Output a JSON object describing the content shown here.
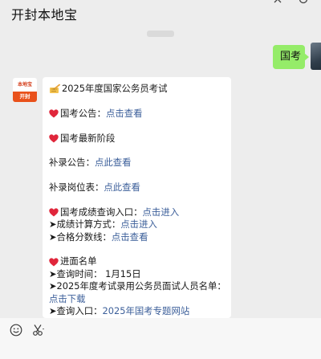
{
  "window": {
    "title": "开封本地宝"
  },
  "chat": {
    "sent": {
      "text": "国考"
    },
    "bot_avatar": {
      "top": "本地宝",
      "bottom": "开封"
    },
    "article": {
      "heading": "2025年度国家公务员考试",
      "l1_label": "国考公告：",
      "l1_link": "点击查看",
      "l2": "国考最新阶段",
      "l3_label": "补录公告：",
      "l3_link": "点此查看",
      "l4_label": "补录岗位表：",
      "l4_link": "点此查看",
      "l5_label": "国考成绩查询入口：",
      "l5_link": "点击进入",
      "l6_label": "➤成绩计算方式：",
      "l6_link": "点击进入",
      "l7_label": "➤合格分数线：",
      "l7_link": "点击查看",
      "l8": "进面名单",
      "l9": "➤查询时间：  1月15日",
      "l10": "➤2025年度考试录用公务员面试人员名单：",
      "l11_link": "点击下载",
      "l12_label": "➤查询入口：",
      "l12_link": "2025年国考专题网站"
    }
  },
  "icons": {
    "memo": "memo-icon",
    "heart": "heart-icon",
    "emoji": "smiley-icon",
    "scissors": "scissors-icon"
  },
  "colors": {
    "background": "#ededed",
    "sent_bubble": "#95ec69",
    "link": "#3c5f9a",
    "heart": "#e0263b"
  }
}
